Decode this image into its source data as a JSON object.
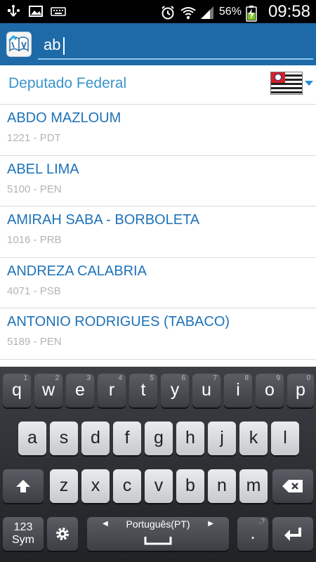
{
  "status_bar": {
    "battery_percent": "56%",
    "time": "09:58",
    "icons": [
      "usb-icon",
      "image-icon",
      "keyboard-icon",
      "alarm-icon",
      "wifi-icon",
      "signal-icon",
      "battery-charging-icon"
    ]
  },
  "search": {
    "value": "ab",
    "app_icon": "app-logo-icon"
  },
  "office": {
    "title": "Deputado Federal",
    "state_flag": "sao-paulo-flag-icon"
  },
  "candidates": [
    {
      "name": "ABDO MAZLOUM",
      "sub": "1221 - PDT"
    },
    {
      "name": "ABEL LIMA",
      "sub": "5100 - PEN"
    },
    {
      "name": "AMIRAH SABA - BORBOLETA",
      "sub": "1016 - PRB"
    },
    {
      "name": "ANDREZA CALABRIA",
      "sub": "4071 - PSB"
    },
    {
      "name": "ANTONIO RODRIGUES (TABACO)",
      "sub": "5189 - PEN"
    }
  ],
  "keyboard": {
    "row1": [
      {
        "k": "q",
        "h": "1"
      },
      {
        "k": "w",
        "h": "2"
      },
      {
        "k": "e",
        "h": "3"
      },
      {
        "k": "r",
        "h": "4"
      },
      {
        "k": "t",
        "h": "5"
      },
      {
        "k": "y",
        "h": "6"
      },
      {
        "k": "u",
        "h": "7"
      },
      {
        "k": "i",
        "h": "8"
      },
      {
        "k": "o",
        "h": "9"
      },
      {
        "k": "p",
        "h": "0"
      }
    ],
    "row2": [
      "a",
      "s",
      "d",
      "f",
      "g",
      "h",
      "j",
      "k",
      "l"
    ],
    "row3": [
      "z",
      "x",
      "c",
      "v",
      "b",
      "n",
      "m"
    ],
    "sym_label_1": "123",
    "sym_label_2": "Sym",
    "space_label": "Português(PT)",
    "dot_label": ".",
    "dot_hint": ",?",
    "colors": {
      "action_bar": "#1e6aa8",
      "link_blue": "#1e72b8",
      "office_blue": "#3a94cc"
    }
  }
}
